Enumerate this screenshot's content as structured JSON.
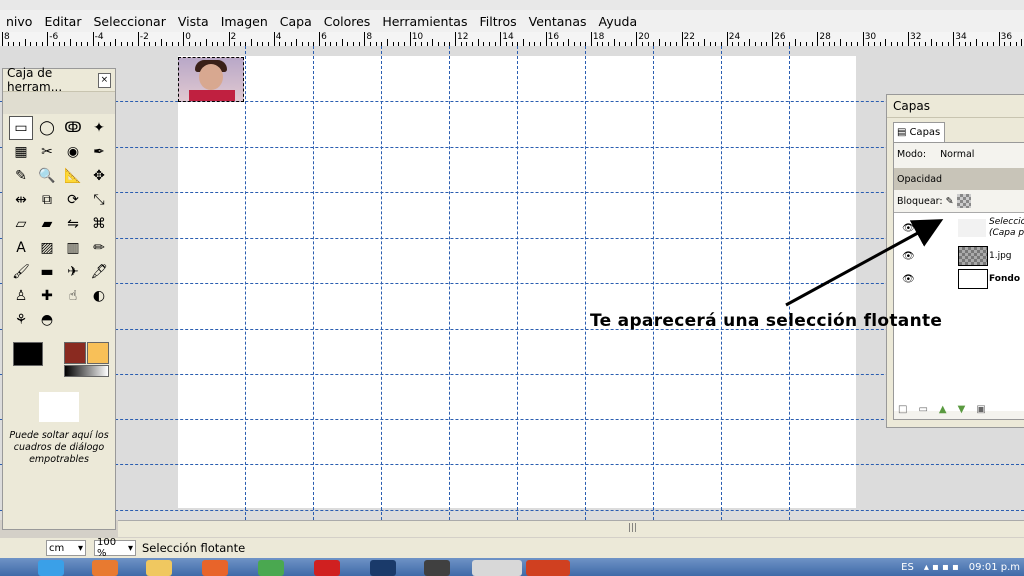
{
  "menu": [
    "nivo",
    "Editar",
    "Seleccionar",
    "Vista",
    "Imagen",
    "Capa",
    "Colores",
    "Herramientas",
    "Filtros",
    "Ventanas",
    "Ayuda"
  ],
  "ruler": {
    "labels": [
      "8",
      "-6",
      "-4",
      "-2",
      "0",
      "2",
      "4",
      "6",
      "8",
      "10",
      "12",
      "14",
      "16",
      "18",
      "20",
      "22",
      "24",
      "26",
      "28",
      "30",
      "32",
      "34",
      "36"
    ]
  },
  "toolbox": {
    "title": "Caja de herram...",
    "close": "×",
    "tools": [
      "rect-select",
      "ellipse-select",
      "free-select",
      "fuzzy-select",
      "by-color-select",
      "scissors",
      "foreground-select",
      "paths",
      "color-picker",
      "zoom",
      "measure",
      "move",
      "align",
      "crop",
      "rotate",
      "scale",
      "shear",
      "perspective",
      "flip",
      "cage",
      "text",
      "bucket-fill",
      "blend",
      "pencil",
      "paintbrush",
      "eraser",
      "airbrush",
      "ink",
      "clone",
      "heal",
      "smudge",
      "dodge-burn",
      "smudge2",
      "dodge"
    ],
    "drop_hint": "Puede soltar aquí los cuadros de diálogo empotrables"
  },
  "layers": {
    "title": "Capas",
    "tab": "Capas",
    "mode_label": "Modo:",
    "mode_value": "Normal",
    "opacity_label": "Opacidad",
    "lock_label": "Bloquear:",
    "items": [
      {
        "name": "Selección",
        "sub": "(Capa p"
      },
      {
        "name": "1.jpg"
      },
      {
        "name": "Fondo"
      }
    ]
  },
  "annotation": "Te aparecerá una selección flotante",
  "status": {
    "unit": "cm",
    "zoom": "100 %",
    "text": "Selección flotante"
  },
  "taskbar": {
    "lang": "ES",
    "time": "09:01 p.m"
  }
}
